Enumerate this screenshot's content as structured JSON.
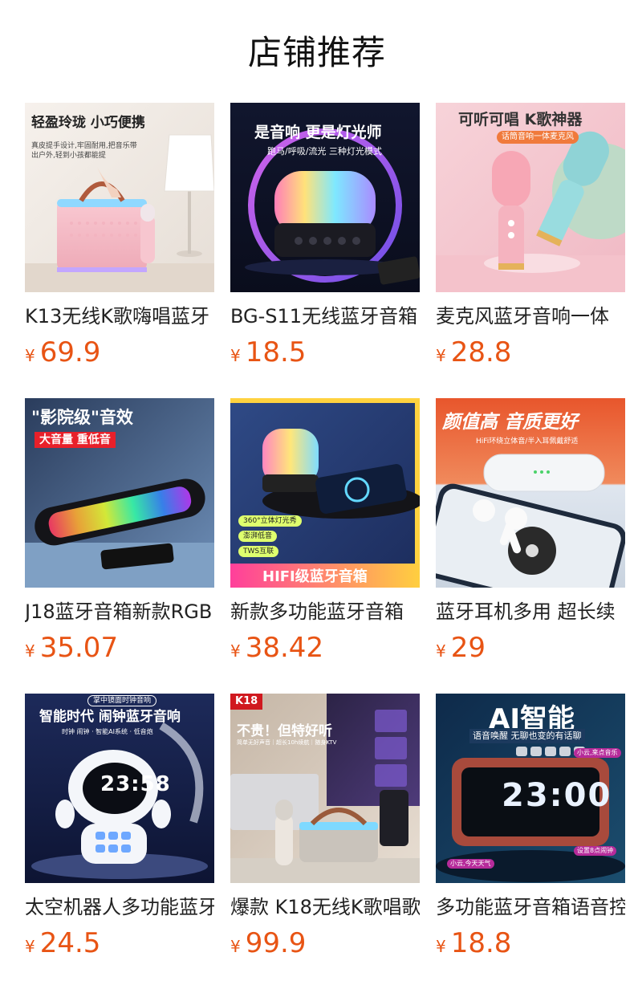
{
  "page_title": "店铺推荐",
  "products": [
    {
      "name": "K13无线K歌嗨唱蓝牙",
      "currency": "¥",
      "price": "69.9",
      "overlay": {
        "title": "轻盈玲珑 小巧便携",
        "subtitle": "真皮提手设计,牢固耐用,把音乐带出户外,轻到小孩都能提"
      }
    },
    {
      "name": "BG-S11无线蓝牙音箱",
      "currency": "¥",
      "price": "18.5",
      "overlay": {
        "title": "是音响 更是灯光师",
        "subtitle": "跑马/呼吸/流光 三种灯光模式"
      }
    },
    {
      "name": "麦克风蓝牙音响一体",
      "currency": "¥",
      "price": "28.8",
      "overlay": {
        "title": "可听可唱 K歌神器",
        "subtitle": "话筒音响一体麦克风"
      }
    },
    {
      "name": "J18蓝牙音箱新款RGB",
      "currency": "¥",
      "price": "35.07",
      "overlay": {
        "title": "\"影院级\"音效",
        "subtitle": "大音量 重低音"
      }
    },
    {
      "name": "新款多功能蓝牙音箱",
      "currency": "¥",
      "price": "38.42",
      "overlay": {
        "title": "HIFI级蓝牙音箱",
        "tags": [
          "360°立体灯光秀",
          "澎湃低音",
          "TWS互联"
        ]
      }
    },
    {
      "name": "蓝牙耳机多用 超长续",
      "currency": "¥",
      "price": "29",
      "overlay": {
        "title": "颜值高 音质更好",
        "subtitle": "HiFi环绕立体音/半入耳佩戴舒适"
      }
    },
    {
      "name": "太空机器人多功能蓝牙",
      "currency": "¥",
      "price": "24.5",
      "overlay": {
        "title": "智能时代 闹钟蓝牙音响",
        "subtitle": "时钟 闹钟 · 智能AI系统 · 低音炮",
        "badge": "掌中镜面时钟音响",
        "clock": "23:58"
      }
    },
    {
      "name": "爆款 K18无线K歌唱歌",
      "currency": "¥",
      "price": "99.9",
      "overlay": {
        "title": "不贵！但特好听",
        "subtitle": "简单无好声音｜超长10h续航｜随身KTV",
        "badge": "K18"
      }
    },
    {
      "name": "多功能蓝牙音箱语音控",
      "currency": "¥",
      "price": "18.8",
      "overlay": {
        "title": "AI智能",
        "subtitle": "语音唤醒 无聊也变的有话聊",
        "clock": "23:00",
        "tag1": "小云,来点音乐",
        "tag2": "设置8点闹钟",
        "tag3": "小云,今天天气"
      }
    }
  ],
  "colors": {
    "price": "#e85414",
    "title": "#111111",
    "name": "#222222"
  }
}
